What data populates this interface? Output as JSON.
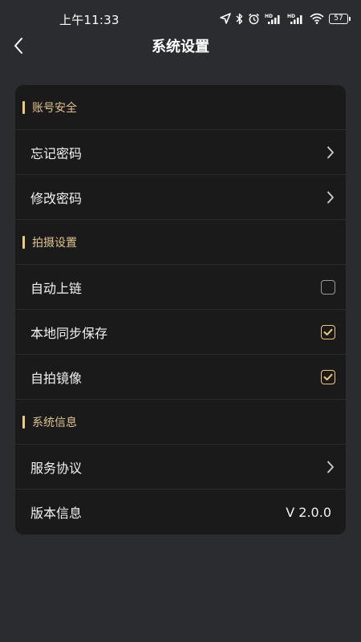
{
  "status_bar": {
    "time": "上午11:33",
    "battery": "57",
    "icons": [
      "location-arrow-icon",
      "bluetooth-icon",
      "alarm-clock-icon",
      "hd-signal-icon",
      "hd-signal-icon",
      "wifi-icon",
      "battery-icon"
    ]
  },
  "header": {
    "title": "系统设置",
    "back_icon": "chevron-left-icon"
  },
  "sections": {
    "account": {
      "title": "账号安全",
      "items": [
        {
          "label": "忘记密码",
          "control": "chevron-right-icon"
        },
        {
          "label": "修改密码",
          "control": "chevron-right-icon"
        }
      ]
    },
    "capture": {
      "title": "拍摄设置",
      "items": [
        {
          "label": "自动上链",
          "checked": false
        },
        {
          "label": "本地同步保存",
          "checked": true
        },
        {
          "label": "自拍镜像",
          "checked": true
        }
      ]
    },
    "system": {
      "title": "系统信息",
      "items": [
        {
          "label": "服务协议",
          "control": "chevron-right-icon"
        },
        {
          "label": "版本信息",
          "value": "V 2.0.0"
        }
      ]
    }
  },
  "colors": {
    "background": "#2a2c2f",
    "card": "#1a1a1b",
    "accent": "#f2c97d",
    "section_text": "#e0c290"
  }
}
